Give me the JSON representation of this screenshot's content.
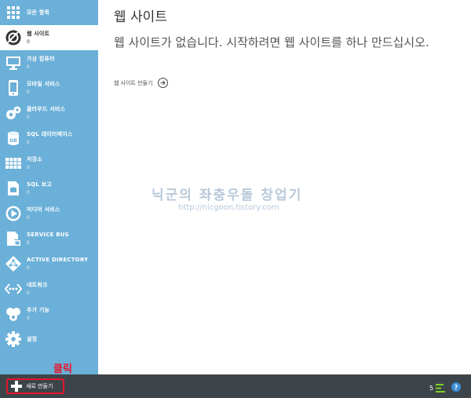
{
  "sidebar": {
    "all_items": "모든 항목",
    "items": [
      {
        "label": "웹 사이트",
        "count": "0",
        "icon": "globe-icon"
      },
      {
        "label": "가상 컴퓨터",
        "count": "0",
        "icon": "monitor-icon"
      },
      {
        "label": "모바일 서비스",
        "count": "0",
        "icon": "mobile-icon"
      },
      {
        "label": "클라우드 서비스",
        "count": "0",
        "icon": "gears-icon"
      },
      {
        "label": "SQL 데이터베이스",
        "count": "0",
        "icon": "database-icon"
      },
      {
        "label": "저장소",
        "count": "0",
        "icon": "storage-grid-icon"
      },
      {
        "label": "SQL 보고",
        "count": "0",
        "icon": "report-icon"
      },
      {
        "label": "미디어 서비스",
        "count": "0",
        "icon": "media-play-icon"
      },
      {
        "label": "SERVICE BUS",
        "count": "0",
        "icon": "service-bus-icon"
      },
      {
        "label": "ACTIVE DIRECTORY",
        "count": "0",
        "icon": "directory-diamond-icon"
      },
      {
        "label": "네트워크",
        "count": "0",
        "icon": "network-icon"
      },
      {
        "label": "추가 기능",
        "count": "0",
        "icon": "addons-icon"
      },
      {
        "label": "설정",
        "count": "",
        "icon": "gear-icon"
      }
    ]
  },
  "main": {
    "title": "웹 사이트",
    "empty_message": "웹 사이트가 없습니다. 시작하려면 웹 사이트를 하나 만드십시오.",
    "create_link": "웹 사이트 만들기"
  },
  "watermark": {
    "title": "닉군의 좌충우돌 창업기",
    "url": "http://nicgoon.tistory.com"
  },
  "bottom_bar": {
    "new_button": "새로 만들기",
    "callout": "클릭",
    "notification_count": "5"
  },
  "colors": {
    "sidebar": "#6bb0d8",
    "bottom_bar": "#3d4449",
    "highlight": "#e8132b"
  }
}
